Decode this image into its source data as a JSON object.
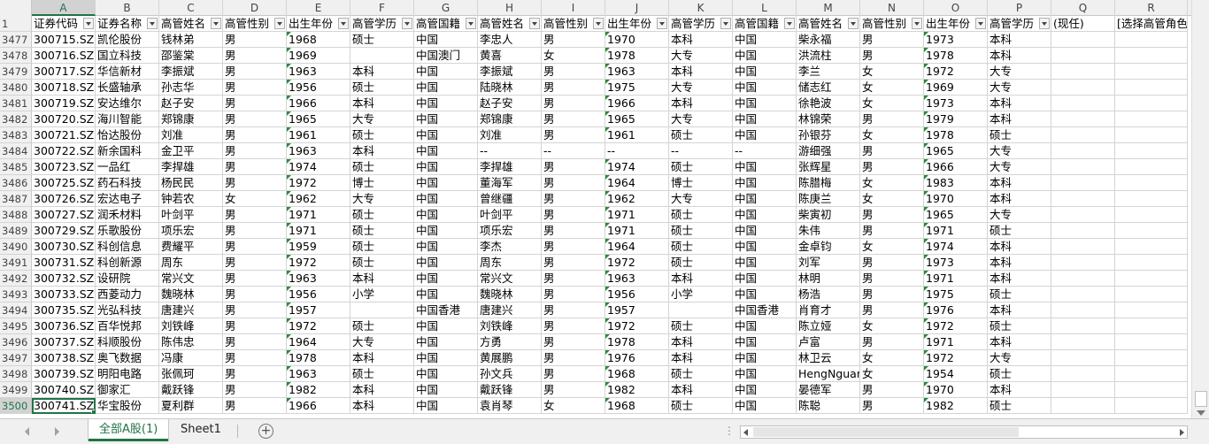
{
  "columns": [
    "A",
    "B",
    "C",
    "D",
    "E",
    "F",
    "G",
    "H",
    "I",
    "J",
    "K",
    "L",
    "M",
    "N",
    "O",
    "P",
    "Q",
    "R"
  ],
  "selected_column": "A",
  "header_row": {
    "num": "1",
    "cells": [
      "证券代码",
      "证券名称",
      "高管姓名",
      "高管性别",
      "出生年份",
      "高管学历",
      "高管国籍",
      "高管姓名",
      "高管性别",
      "出生年份",
      "高管学历",
      "高管国籍",
      "高管姓名",
      "高管性别",
      "出生年份",
      "高管学历",
      "(现任)",
      "[选择高管角色]"
    ]
  },
  "rows": [
    {
      "num": "3477",
      "cells": [
        "300715.SZ",
        "凯伦股份",
        "钱林弟",
        "男",
        "1968",
        "硕士",
        "中国",
        "李忠人",
        "男",
        "1970",
        "本科",
        "中国",
        "柴永福",
        "男",
        "1973",
        "本科",
        "",
        ""
      ]
    },
    {
      "num": "3478",
      "cells": [
        "300716.SZ",
        "国立科技",
        "邵鉴棠",
        "男",
        "1969",
        "",
        "中国澳门",
        "黄喜",
        "女",
        "1978",
        "大专",
        "中国",
        "洪流柱",
        "男",
        "1978",
        "本科",
        "",
        ""
      ]
    },
    {
      "num": "3479",
      "cells": [
        "300717.SZ",
        "华信新材",
        "李振斌",
        "男",
        "1963",
        "本科",
        "中国",
        "李振斌",
        "男",
        "1963",
        "本科",
        "中国",
        "李兰",
        "女",
        "1972",
        "大专",
        "",
        ""
      ]
    },
    {
      "num": "3480",
      "cells": [
        "300718.SZ",
        "长盛轴承",
        "孙志华",
        "男",
        "1956",
        "硕士",
        "中国",
        "陆晓林",
        "男",
        "1975",
        "大专",
        "中国",
        "储志红",
        "女",
        "1969",
        "大专",
        "",
        ""
      ]
    },
    {
      "num": "3481",
      "cells": [
        "300719.SZ",
        "安达维尔",
        "赵子安",
        "男",
        "1966",
        "本科",
        "中国",
        "赵子安",
        "男",
        "1966",
        "本科",
        "中国",
        "徐艳波",
        "女",
        "1973",
        "本科",
        "",
        ""
      ]
    },
    {
      "num": "3482",
      "cells": [
        "300720.SZ",
        "海川智能",
        "郑锦康",
        "男",
        "1965",
        "大专",
        "中国",
        "郑锦康",
        "男",
        "1965",
        "大专",
        "中国",
        "林锦荣",
        "男",
        "1979",
        "本科",
        "",
        ""
      ]
    },
    {
      "num": "3483",
      "cells": [
        "300721.SZ",
        "怡达股份",
        "刘准",
        "男",
        "1961",
        "硕士",
        "中国",
        "刘准",
        "男",
        "1961",
        "硕士",
        "中国",
        "孙银芬",
        "女",
        "1978",
        "硕士",
        "",
        ""
      ]
    },
    {
      "num": "3484",
      "cells": [
        "300722.SZ",
        "新余国科",
        "金卫平",
        "男",
        "1963",
        "本科",
        "中国",
        "--",
        "--",
        "--",
        "--",
        "--",
        "游细强",
        "男",
        "1965",
        "大专",
        "",
        ""
      ]
    },
    {
      "num": "3485",
      "cells": [
        "300723.SZ",
        "一品红",
        "李捍雄",
        "男",
        "1974",
        "硕士",
        "中国",
        "李捍雄",
        "男",
        "1974",
        "硕士",
        "中国",
        "张辉星",
        "男",
        "1966",
        "大专",
        "",
        ""
      ]
    },
    {
      "num": "3486",
      "cells": [
        "300725.SZ",
        "药石科技",
        "杨民民",
        "男",
        "1972",
        "博士",
        "中国",
        "董海军",
        "男",
        "1964",
        "博士",
        "中国",
        "陈腊梅",
        "女",
        "1983",
        "本科",
        "",
        ""
      ]
    },
    {
      "num": "3487",
      "cells": [
        "300726.SZ",
        "宏达电子",
        "钟若农",
        "女",
        "1962",
        "大专",
        "中国",
        "曾继疆",
        "男",
        "1962",
        "大专",
        "中国",
        "陈庚兰",
        "女",
        "1970",
        "本科",
        "",
        ""
      ]
    },
    {
      "num": "3488",
      "cells": [
        "300727.SZ",
        "润禾材料",
        "叶剑平",
        "男",
        "1971",
        "硕士",
        "中国",
        "叶剑平",
        "男",
        "1971",
        "硕士",
        "中国",
        "柴寅初",
        "男",
        "1965",
        "大专",
        "",
        ""
      ]
    },
    {
      "num": "3489",
      "cells": [
        "300729.SZ",
        "乐歌股份",
        "项乐宏",
        "男",
        "1971",
        "硕士",
        "中国",
        "项乐宏",
        "男",
        "1971",
        "硕士",
        "中国",
        "朱伟",
        "男",
        "1971",
        "硕士",
        "",
        ""
      ]
    },
    {
      "num": "3490",
      "cells": [
        "300730.SZ",
        "科创信息",
        "费耀平",
        "男",
        "1959",
        "硕士",
        "中国",
        "李杰",
        "男",
        "1964",
        "硕士",
        "中国",
        "金卓钧",
        "女",
        "1974",
        "本科",
        "",
        ""
      ]
    },
    {
      "num": "3491",
      "cells": [
        "300731.SZ",
        "科创新源",
        "周东",
        "男",
        "1972",
        "硕士",
        "中国",
        "周东",
        "男",
        "1972",
        "硕士",
        "中国",
        "刘军",
        "男",
        "1973",
        "本科",
        "",
        ""
      ]
    },
    {
      "num": "3492",
      "cells": [
        "300732.SZ",
        "设研院",
        "常兴文",
        "男",
        "1963",
        "本科",
        "中国",
        "常兴文",
        "男",
        "1963",
        "本科",
        "中国",
        "林明",
        "男",
        "1971",
        "本科",
        "",
        ""
      ]
    },
    {
      "num": "3493",
      "cells": [
        "300733.SZ",
        "西菱动力",
        "魏晓林",
        "男",
        "1956",
        "小学",
        "中国",
        "魏晓林",
        "男",
        "1956",
        "小学",
        "中国",
        "杨浩",
        "男",
        "1975",
        "硕士",
        "",
        ""
      ]
    },
    {
      "num": "3494",
      "cells": [
        "300735.SZ",
        "光弘科技",
        "唐建兴",
        "男",
        "1957",
        "",
        "中国香港",
        "唐建兴",
        "男",
        "1957",
        "",
        "中国香港",
        "肖育才",
        "男",
        "1976",
        "本科",
        "",
        ""
      ]
    },
    {
      "num": "3495",
      "cells": [
        "300736.SZ",
        "百华悦邦",
        "刘铁峰",
        "男",
        "1972",
        "硕士",
        "中国",
        "刘铁峰",
        "男",
        "1972",
        "硕士",
        "中国",
        "陈立娅",
        "女",
        "1972",
        "硕士",
        "",
        ""
      ]
    },
    {
      "num": "3496",
      "cells": [
        "300737.SZ",
        "科顺股份",
        "陈伟忠",
        "男",
        "1964",
        "大专",
        "中国",
        "方勇",
        "男",
        "1978",
        "本科",
        "中国",
        "卢富",
        "男",
        "1971",
        "本科",
        "",
        ""
      ]
    },
    {
      "num": "3497",
      "cells": [
        "300738.SZ",
        "奥飞数据",
        "冯康",
        "男",
        "1978",
        "本科",
        "中国",
        "黄展鹏",
        "男",
        "1976",
        "本科",
        "中国",
        "林卫云",
        "女",
        "1972",
        "大专",
        "",
        ""
      ]
    },
    {
      "num": "3498",
      "cells": [
        "300739.SZ",
        "明阳电路",
        "张佩珂",
        "男",
        "1963",
        "硕士",
        "中国",
        "孙文兵",
        "男",
        "1968",
        "硕士",
        "中国",
        "HengNguan",
        "女",
        "1954",
        "硕士",
        "",
        ""
      ]
    },
    {
      "num": "3499",
      "cells": [
        "300740.SZ",
        "御家汇",
        "戴跃锋",
        "男",
        "1982",
        "本科",
        "中国",
        "戴跃锋",
        "男",
        "1982",
        "本科",
        "中国",
        "晏德军",
        "男",
        "1970",
        "本科",
        "",
        ""
      ]
    },
    {
      "num": "3500",
      "cells": [
        "300741.SZ",
        "华宝股份",
        "夏利群",
        "男",
        "1966",
        "本科",
        "中国",
        "袁肖琴",
        "女",
        "1968",
        "硕士",
        "中国",
        "陈聪",
        "男",
        "1982",
        "硕士",
        "",
        ""
      ]
    }
  ],
  "selected_row": "3500",
  "sheet_tabs": {
    "active": "全部A股(1)",
    "other": "Sheet1",
    "add_label": "+",
    "menu_dots": "⋮"
  },
  "colors": {
    "accent": "#217346",
    "triangle": "#2a8a3a"
  }
}
